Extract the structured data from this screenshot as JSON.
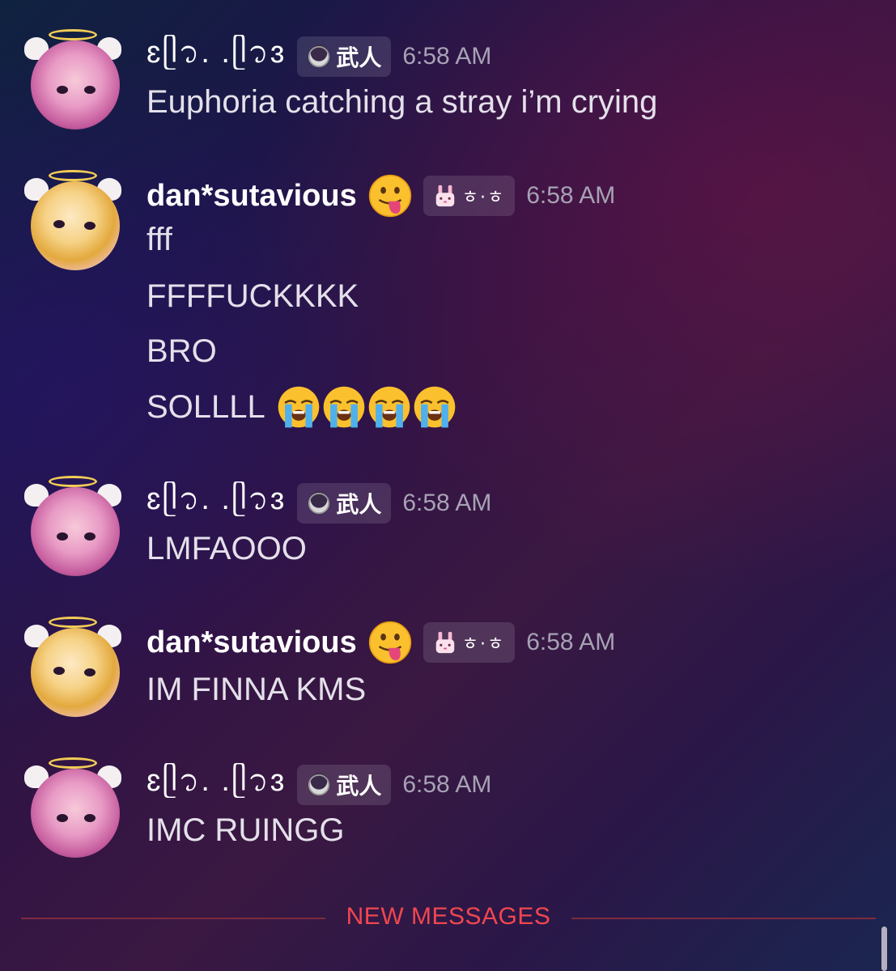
{
  "colors": {
    "username": "#ffffff",
    "message_text": "#e4e0ea",
    "timestamp": "#a7a2b4",
    "new_messages": "#f0474f",
    "divider_rule": "#7e2a3e"
  },
  "messages": [
    {
      "username": "ɛᥫ᭡. .ᥫ᭡ɜ",
      "avatar": "pink-hair-angel-avatar",
      "tag_icon": "moon-icon",
      "tag_text": "武人",
      "time": "6:58 AM",
      "lines": [
        "Euphoria catching a stray i’m crying"
      ]
    },
    {
      "username": "dan*sutavious",
      "avatar": "blonde-angel-avatar",
      "status_emoji": "tongue-out-emoji",
      "tag_icon": "bunny-icon",
      "tag_text": "ㅎ·ㅎ",
      "time": "6:58 AM",
      "lines": [
        "fff",
        "FFFFUCKKKK",
        "BRO",
        "SOLLLL"
      ],
      "last_line_emojis": [
        "loudly-crying-emoji",
        "loudly-crying-emoji",
        "loudly-crying-emoji",
        "loudly-crying-emoji"
      ]
    },
    {
      "username": "ɛᥫ᭡. .ᥫ᭡ɜ",
      "avatar": "pink-hair-angel-avatar",
      "tag_icon": "moon-icon",
      "tag_text": "武人",
      "time": "6:58 AM",
      "lines": [
        "LMFAOOO"
      ]
    },
    {
      "username": "dan*sutavious",
      "avatar": "blonde-angel-avatar",
      "status_emoji": "tongue-out-emoji",
      "tag_icon": "bunny-icon",
      "tag_text": "ㅎ·ㅎ",
      "time": "6:58 AM",
      "lines": [
        "IM FINNA KMS"
      ]
    },
    {
      "username": "ɛᥫ᭡. .ᥫ᭡ɜ",
      "avatar": "pink-hair-angel-avatar",
      "tag_icon": "moon-icon",
      "tag_text": "武人",
      "time": "6:58 AM",
      "lines": [
        "IMC RUINGG"
      ]
    }
  ],
  "divider": {
    "label": "NEW MESSAGES"
  }
}
